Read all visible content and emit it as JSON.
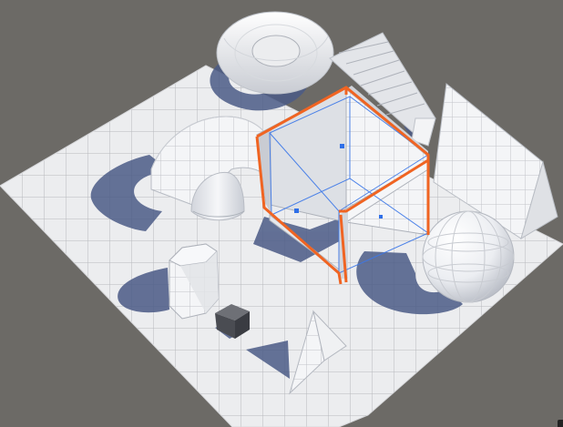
{
  "scene": {
    "view": "isometric",
    "selected_object": "box-frame",
    "objects": [
      "torus",
      "stairs",
      "arch",
      "half-cylinder",
      "box-frame",
      "plane-wedge",
      "sphere",
      "hexagonal-prism",
      "cube",
      "wedge"
    ]
  },
  "colors": {
    "background": "#6c6a66",
    "ground": "#ecedef",
    "grid_line": "#b7b9be",
    "shadow": "#4b5a86",
    "selection_outline": "#f06422",
    "selection_bounds": "#3d78e8"
  },
  "icons": {
    "selection_pivot": "square-dot-icon",
    "corner_handle": "resize-handle-icon"
  }
}
